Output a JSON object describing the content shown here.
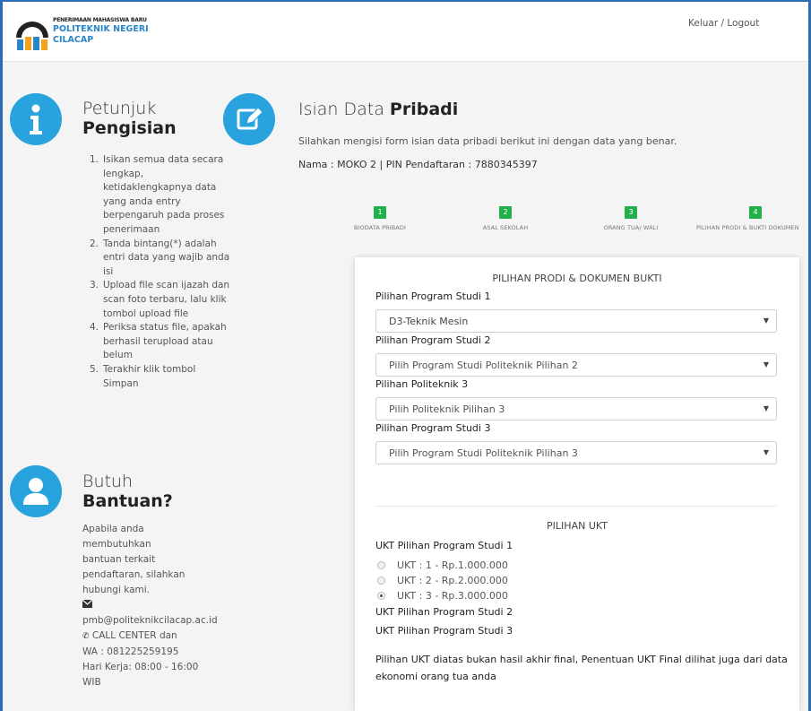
{
  "header": {
    "logo_small": "PENERIMAAN MAHASISWA BARU",
    "logo_line1": "POLITEKNIK NEGERI",
    "logo_line2": "CILACAP",
    "logout": "Keluar / Logout"
  },
  "instructions": {
    "title_light": "Petunjuk",
    "title_bold": "Pengisian",
    "items": [
      {
        "num": "1.",
        "text": "Isikan semua data secara lengkap, ketidaklengkapnya data yang anda entry berpengaruh pada proses penerimaan"
      },
      {
        "num": "2.",
        "text": "Tanda bintang(*) adalah entri data yang wajib anda isi"
      },
      {
        "num": "3.",
        "text": "Upload file scan ijazah dan scan foto terbaru, lalu klik tombol upload file"
      },
      {
        "num": "4.",
        "text": "Periksa status file, apakah berhasil terupload atau belum"
      },
      {
        "num": "5.",
        "text": "Terakhir klik tombol Simpan"
      }
    ]
  },
  "help": {
    "title_light": "Butuh",
    "title_bold": "Bantuan?",
    "lines": [
      "Apabila anda",
      "membutuhkan",
      "bantuan terkait",
      "pendaftaran, silahkan",
      "hubungi kami."
    ],
    "email": "pmb@politeknikcilacap.ac.id",
    "callcenter": "CALL CENTER dan",
    "wa": "WA : 081225259195",
    "hours": "Hari Kerja: 08:00 - 16:00",
    "hours2": "WIB"
  },
  "main": {
    "title_light": "Isian Data",
    "title_bold": "Pribadi",
    "subtitle": "Silahkan mengisi form isian data pribadi berikut ini dengan data yang benar.",
    "name_line": "Nama : MOKO 2 | PIN Pendaftaran : 7880345397"
  },
  "steps": [
    {
      "num": "1",
      "label": "BIODATA PRIBADI"
    },
    {
      "num": "2",
      "label": "ASAL SEKOLAH"
    },
    {
      "num": "3",
      "label": "ORANG TUA/ WALI"
    },
    {
      "num": "4",
      "label": "PILIHAN PRODI & BUKTI DOKUMEN"
    }
  ],
  "form": {
    "section_title": "PILIHAN PRODI & DOKUMEN BUKTI",
    "fields": [
      {
        "label": "Pilihan Program Studi 1",
        "value": "D3-Teknik Mesin"
      },
      {
        "label": "Pilihan Program Studi 2",
        "value": "Pilih Program Studi Politeknik Pilihan 2"
      },
      {
        "label": "Pilihan Politeknik 3",
        "value": "Pilih Politeknik Pilihan 3"
      },
      {
        "label": "Pilihan Program Studi 3",
        "value": "Pilih Program Studi Politeknik Pilihan 3"
      }
    ],
    "ukt_title": "PILIHAN UKT",
    "ukt1_label": "UKT Pilihan Program Studi 1",
    "ukt_options": [
      {
        "label": "UKT : 1 - Rp.1.000.000",
        "checked": false
      },
      {
        "label": "UKT : 2 - Rp.2.000.000",
        "checked": false
      },
      {
        "label": "UKT : 3 - Rp.3.000.000",
        "checked": true
      }
    ],
    "ukt2_label": "UKT Pilihan Program Studi 2",
    "ukt3_label": "UKT Pilihan Program Studi 3",
    "note": "Pilihan UKT diatas bukan hasil akhir final, Penentuan UKT Final dilihat juga dari data ekonomi orang tua anda"
  }
}
